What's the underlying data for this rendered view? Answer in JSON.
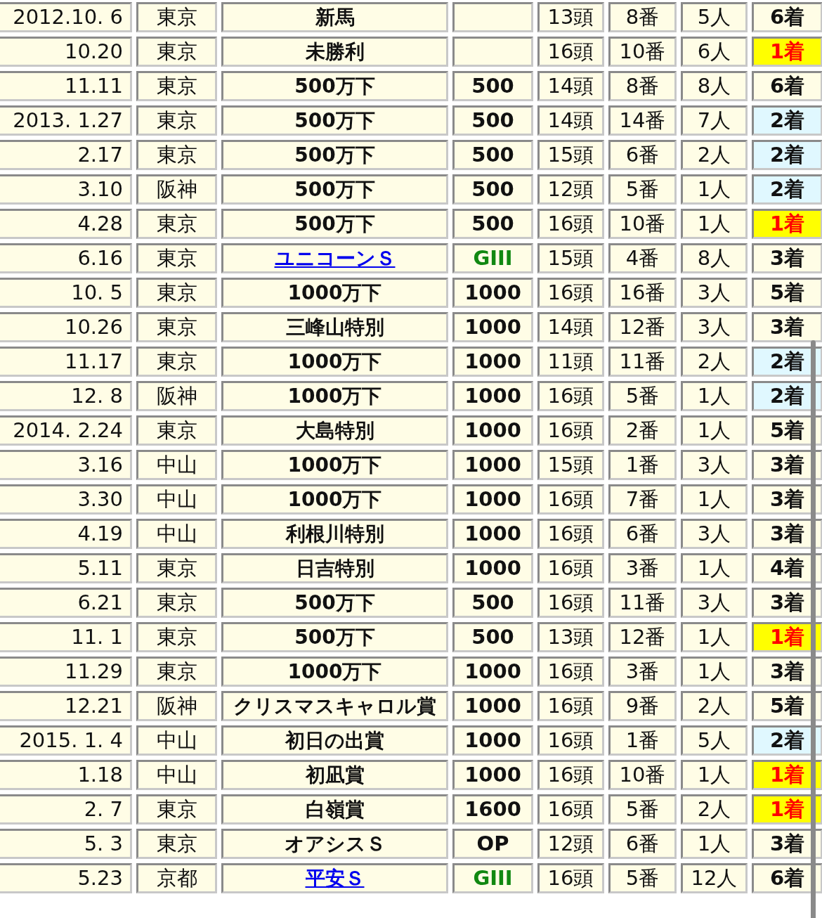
{
  "races": [
    {
      "date": "2012.10. 6",
      "venue": "東京",
      "race": "新馬",
      "race_link": false,
      "field": "13頭",
      "draw": "8番",
      "popularity": "5人",
      "result": {
        "text": "6着",
        "kind": "other"
      }
    },
    {
      "date": "10.20",
      "venue": "東京",
      "race": "未勝利",
      "race_link": false,
      "field": "16頭",
      "draw": "10番",
      "popularity": "6人",
      "result": {
        "text": "1着",
        "kind": "win"
      }
    },
    {
      "date": "11.11",
      "venue": "東京",
      "race": "500万下",
      "race_link": false,
      "class": {
        "text": "500",
        "kind": "plain"
      },
      "field": "14頭",
      "draw": "8番",
      "popularity": "8人",
      "result": {
        "text": "6着",
        "kind": "other"
      }
    },
    {
      "date": "2013. 1.27",
      "venue": "東京",
      "race": "500万下",
      "race_link": false,
      "class": {
        "text": "500",
        "kind": "plain"
      },
      "field": "14頭",
      "draw": "14番",
      "popularity": "7人",
      "result": {
        "text": "2着",
        "kind": "second"
      }
    },
    {
      "date": "2.17",
      "venue": "東京",
      "race": "500万下",
      "race_link": false,
      "class": {
        "text": "500",
        "kind": "plain"
      },
      "field": "15頭",
      "draw": "6番",
      "popularity": "2人",
      "result": {
        "text": "2着",
        "kind": "second"
      }
    },
    {
      "date": "3.10",
      "venue": "阪神",
      "race": "500万下",
      "race_link": false,
      "class": {
        "text": "500",
        "kind": "plain"
      },
      "field": "12頭",
      "draw": "5番",
      "popularity": "1人",
      "result": {
        "text": "2着",
        "kind": "second"
      }
    },
    {
      "date": "4.28",
      "venue": "東京",
      "race": "500万下",
      "race_link": false,
      "class": {
        "text": "500",
        "kind": "plain"
      },
      "field": "16頭",
      "draw": "10番",
      "popularity": "1人",
      "result": {
        "text": "1着",
        "kind": "win"
      }
    },
    {
      "date": "6.16",
      "venue": "東京",
      "race": "ユニコーンＳ",
      "race_link": true,
      "class": {
        "text": "GIII",
        "kind": "grade"
      },
      "field": "15頭",
      "draw": "4番",
      "popularity": "8人",
      "result": {
        "text": "3着",
        "kind": "other"
      }
    },
    {
      "date": "10. 5",
      "venue": "東京",
      "race": "1000万下",
      "race_link": false,
      "class": {
        "text": "1000",
        "kind": "plain"
      },
      "field": "16頭",
      "draw": "16番",
      "popularity": "3人",
      "result": {
        "text": "5着",
        "kind": "other"
      }
    },
    {
      "date": "10.26",
      "venue": "東京",
      "race": "三峰山特別",
      "race_link": false,
      "class": {
        "text": "1000",
        "kind": "plain"
      },
      "field": "14頭",
      "draw": "12番",
      "popularity": "3人",
      "result": {
        "text": "3着",
        "kind": "other"
      }
    },
    {
      "date": "11.17",
      "venue": "東京",
      "race": "1000万下",
      "race_link": false,
      "class": {
        "text": "1000",
        "kind": "plain"
      },
      "field": "11頭",
      "draw": "11番",
      "popularity": "2人",
      "result": {
        "text": "2着",
        "kind": "second"
      }
    },
    {
      "date": "12. 8",
      "venue": "阪神",
      "race": "1000万下",
      "race_link": false,
      "class": {
        "text": "1000",
        "kind": "plain"
      },
      "field": "16頭",
      "draw": "5番",
      "popularity": "1人",
      "result": {
        "text": "2着",
        "kind": "second"
      }
    },
    {
      "date": "2014. 2.24",
      "venue": "東京",
      "race": "大島特別",
      "race_link": false,
      "class": {
        "text": "1000",
        "kind": "plain"
      },
      "field": "16頭",
      "draw": "2番",
      "popularity": "1人",
      "result": {
        "text": "5着",
        "kind": "other"
      }
    },
    {
      "date": "3.16",
      "venue": "中山",
      "race": "1000万下",
      "race_link": false,
      "class": {
        "text": "1000",
        "kind": "plain"
      },
      "field": "15頭",
      "draw": "1番",
      "popularity": "3人",
      "result": {
        "text": "3着",
        "kind": "other"
      }
    },
    {
      "date": "3.30",
      "venue": "中山",
      "race": "1000万下",
      "race_link": false,
      "class": {
        "text": "1000",
        "kind": "plain"
      },
      "field": "16頭",
      "draw": "7番",
      "popularity": "1人",
      "result": {
        "text": "3着",
        "kind": "other"
      }
    },
    {
      "date": "4.19",
      "venue": "中山",
      "race": "利根川特別",
      "race_link": false,
      "class": {
        "text": "1000",
        "kind": "plain"
      },
      "field": "16頭",
      "draw": "6番",
      "popularity": "3人",
      "result": {
        "text": "3着",
        "kind": "other"
      }
    },
    {
      "date": "5.11",
      "venue": "東京",
      "race": "日吉特別",
      "race_link": false,
      "class": {
        "text": "1000",
        "kind": "plain"
      },
      "field": "16頭",
      "draw": "3番",
      "popularity": "1人",
      "result": {
        "text": "4着",
        "kind": "other"
      }
    },
    {
      "date": "6.21",
      "venue": "東京",
      "race": "500万下",
      "race_link": false,
      "class": {
        "text": "500",
        "kind": "plain"
      },
      "field": "16頭",
      "draw": "11番",
      "popularity": "3人",
      "result": {
        "text": "3着",
        "kind": "other"
      }
    },
    {
      "date": "11. 1",
      "venue": "東京",
      "race": "500万下",
      "race_link": false,
      "class": {
        "text": "500",
        "kind": "plain"
      },
      "field": "13頭",
      "draw": "12番",
      "popularity": "1人",
      "result": {
        "text": "1着",
        "kind": "win"
      }
    },
    {
      "date": "11.29",
      "venue": "東京",
      "race": "1000万下",
      "race_link": false,
      "class": {
        "text": "1000",
        "kind": "plain"
      },
      "field": "16頭",
      "draw": "3番",
      "popularity": "1人",
      "result": {
        "text": "3着",
        "kind": "other"
      }
    },
    {
      "date": "12.21",
      "venue": "阪神",
      "race": "クリスマスキャロル賞",
      "race_link": false,
      "class": {
        "text": "1000",
        "kind": "plain"
      },
      "field": "16頭",
      "draw": "9番",
      "popularity": "2人",
      "result": {
        "text": "5着",
        "kind": "other"
      }
    },
    {
      "date": "2015. 1. 4",
      "venue": "中山",
      "race": "初日の出賞",
      "race_link": false,
      "class": {
        "text": "1000",
        "kind": "plain"
      },
      "field": "16頭",
      "draw": "1番",
      "popularity": "5人",
      "result": {
        "text": "2着",
        "kind": "second"
      }
    },
    {
      "date": "1.18",
      "venue": "中山",
      "race": "初凪賞",
      "race_link": false,
      "class": {
        "text": "1000",
        "kind": "plain"
      },
      "field": "16頭",
      "draw": "10番",
      "popularity": "1人",
      "result": {
        "text": "1着",
        "kind": "win"
      }
    },
    {
      "date": "2. 7",
      "venue": "東京",
      "race": "白嶺賞",
      "race_link": false,
      "class": {
        "text": "1600",
        "kind": "plain"
      },
      "field": "16頭",
      "draw": "5番",
      "popularity": "2人",
      "result": {
        "text": "1着",
        "kind": "win"
      }
    },
    {
      "date": "5. 3",
      "venue": "東京",
      "race": "オアシスＳ",
      "race_link": false,
      "class": {
        "text": "OP",
        "kind": "plain"
      },
      "field": "12頭",
      "draw": "6番",
      "popularity": "1人",
      "result": {
        "text": "3着",
        "kind": "other"
      }
    },
    {
      "date": "5.23",
      "venue": "京都",
      "race": "平安Ｓ",
      "race_link": true,
      "class": {
        "text": "GIII",
        "kind": "grade"
      },
      "field": "16頭",
      "draw": "5番",
      "popularity": "12人",
      "result": {
        "text": "6着",
        "kind": "other"
      }
    }
  ]
}
